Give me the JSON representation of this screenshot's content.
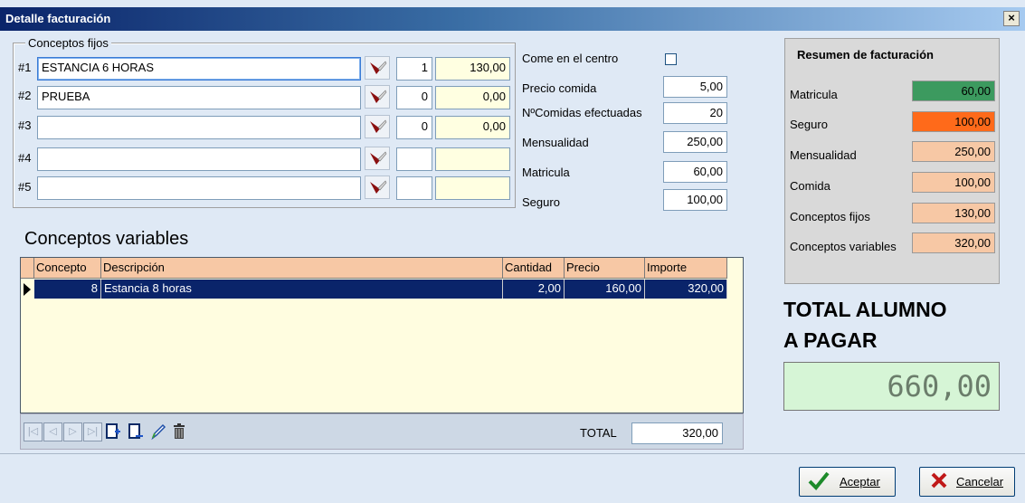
{
  "window": {
    "title": "Detalle facturación",
    "close_label": "×"
  },
  "conceptos_fijos": {
    "group_label": "Conceptos fijos",
    "rows": [
      {
        "label": "#1",
        "descripcion": "ESTANCIA 6 HORAS",
        "cantidad": "1",
        "importe": "130,00"
      },
      {
        "label": "#2",
        "descripcion": "PRUEBA",
        "cantidad": "0",
        "importe": "0,00"
      },
      {
        "label": "#3",
        "descripcion": "",
        "cantidad": "0",
        "importe": "0,00"
      },
      {
        "label": "#4",
        "descripcion": "",
        "cantidad": "",
        "importe": ""
      },
      {
        "label": "#5",
        "descripcion": "",
        "cantidad": "",
        "importe": ""
      }
    ]
  },
  "opciones": {
    "come_en_el_centro_label": "Come en el centro",
    "come_en_el_centro_checked": false,
    "precio_comida_label": "Precio comida",
    "precio_comida": "5,00",
    "num_comidas_label": "NºComidas efectuadas",
    "num_comidas": "20",
    "mensualidad_label": "Mensualidad",
    "mensualidad": "250,00",
    "matricula_label": "Matricula",
    "matricula": "60,00",
    "seguro_label": "Seguro",
    "seguro": "100,00"
  },
  "resumen": {
    "title": "Resumen de facturación",
    "items": [
      {
        "label": "Matricula",
        "value": "60,00",
        "color": "#3c9a5f"
      },
      {
        "label": "Seguro",
        "value": "100,00",
        "color": "#ff6a1a"
      },
      {
        "label": "Mensualidad",
        "value": "250,00",
        "color": "#f7c8a5"
      },
      {
        "label": "Comida",
        "value": "100,00",
        "color": "#f7c8a5"
      },
      {
        "label": "Conceptos fijos",
        "value": "130,00",
        "color": "#f7c8a5"
      },
      {
        "label": "Conceptos variables",
        "value": "320,00",
        "color": "#f7c8a5"
      }
    ]
  },
  "conceptos_variables": {
    "title": "Conceptos variables",
    "columns": [
      "Concepto",
      "Descripción",
      "Cantidad",
      "Precio",
      "Importe"
    ],
    "rows": [
      {
        "concepto": "8",
        "descripcion": "Estancia 8 horas",
        "cantidad": "2,00",
        "precio": "160,00",
        "importe": "320,00"
      }
    ],
    "total_label": "TOTAL",
    "total": "320,00"
  },
  "total_alumno": {
    "title_line1": "TOTAL ALUMNO",
    "title_line2": "A PAGAR",
    "value": "660,00"
  },
  "buttons": {
    "aceptar": "Aceptar",
    "cancelar": "Cancelar"
  },
  "icons": {
    "brush": "brush-icon",
    "first": "first-record-icon",
    "prior": "prior-record-icon",
    "next": "next-record-icon",
    "last": "last-record-icon",
    "insert": "insert-record-icon",
    "append": "append-record-icon",
    "edit": "edit-record-icon",
    "delete": "delete-record-icon"
  }
}
